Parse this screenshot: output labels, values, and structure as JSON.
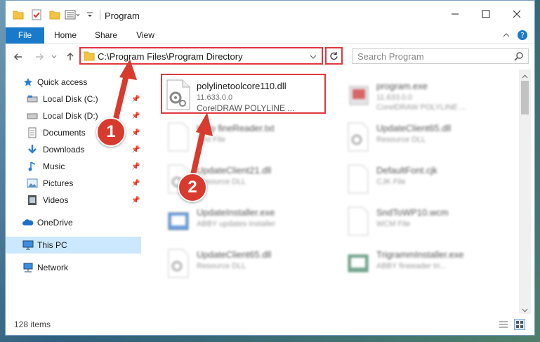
{
  "window": {
    "title": "Program",
    "quick_access_icons": [
      "folder-icon",
      "checkmark-properties-icon",
      "new-folder-icon",
      "view-options-icon",
      "customize-dropdown-icon"
    ]
  },
  "ribbon": {
    "tabs": [
      {
        "label": "File",
        "active": true
      },
      {
        "label": "Home"
      },
      {
        "label": "Share"
      },
      {
        "label": "View"
      }
    ]
  },
  "address": {
    "path": "C:\\Program Files\\Program Directory",
    "search_placeholder": "Search Program"
  },
  "nav": {
    "items": [
      {
        "label": "Quick access",
        "icon": "star-icon"
      },
      {
        "label": "Local Disk (C:)",
        "icon": "drive-icon",
        "pinned": true
      },
      {
        "label": "Local Disk (D:)",
        "icon": "drive-icon",
        "pinned": true
      },
      {
        "label": "Documents",
        "icon": "documents-icon",
        "pinned": true
      },
      {
        "label": "Downloads",
        "icon": "download-icon",
        "pinned": true
      },
      {
        "label": "Music",
        "icon": "music-icon",
        "pinned": true
      },
      {
        "label": "Pictures",
        "icon": "pictures-icon",
        "pinned": true
      },
      {
        "label": "Videos",
        "icon": "videos-icon",
        "pinned": true
      },
      {
        "label": "OneDrive",
        "icon": "cloud-icon"
      },
      {
        "label": "This PC",
        "icon": "computer-icon",
        "selected": true
      },
      {
        "label": "Network",
        "icon": "network-icon"
      }
    ]
  },
  "files": [
    {
      "name": "polylinetoolcore110.dll",
      "line2": "11.633.0.0",
      "line3": "CorelDRAW POLYLINE ...",
      "highlighted": true
    },
    {
      "name": "program.exe",
      "line2": "11.633.0.0",
      "line3": "CorelDRAW POLYLINE ..."
    },
    {
      "name": "Help fineReader.txt",
      "line2": "Text File",
      "line3": ""
    },
    {
      "name": "UpdateClient65.dll",
      "line2": "Resource DLL",
      "line3": ""
    },
    {
      "name": "UpdateClient21.dll",
      "line2": "Resource DLL",
      "line3": ""
    },
    {
      "name": "DefaultFont.cjk",
      "line2": "CJK File",
      "line3": ""
    },
    {
      "name": "UpdateInstaller.exe",
      "line2": "ABBY updates installer",
      "line3": ""
    },
    {
      "name": "SndToWP10.wcm",
      "line2": "WCM File",
      "line3": ""
    },
    {
      "name": "UpdateClient65.dll",
      "line2": "Resource DLL",
      "line3": ""
    },
    {
      "name": "TrigrammInstaller.exe",
      "line2": "ABBY fineeader tri...",
      "line3": ""
    }
  ],
  "status": {
    "item_count": "128 items"
  },
  "annotations": {
    "step1": "1",
    "step2": "2",
    "accent_color": "#e0383e"
  }
}
